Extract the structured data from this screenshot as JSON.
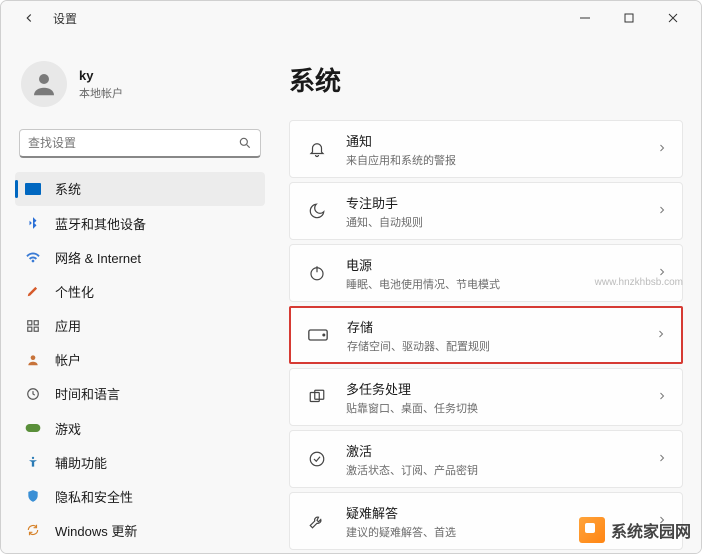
{
  "window": {
    "title": "设置"
  },
  "profile": {
    "name": "ky",
    "subtitle": "本地帐户"
  },
  "search": {
    "placeholder": "查找设置"
  },
  "nav": {
    "items": [
      {
        "label": "系统"
      },
      {
        "label": "蓝牙和其他设备"
      },
      {
        "label": "网络 & Internet"
      },
      {
        "label": "个性化"
      },
      {
        "label": "应用"
      },
      {
        "label": "帐户"
      },
      {
        "label": "时间和语言"
      },
      {
        "label": "游戏"
      },
      {
        "label": "辅助功能"
      },
      {
        "label": "隐私和安全性"
      },
      {
        "label": "Windows 更新"
      }
    ]
  },
  "main": {
    "heading": "系统",
    "cards": [
      {
        "title": "通知",
        "subtitle": "来自应用和系统的警报"
      },
      {
        "title": "专注助手",
        "subtitle": "通知、自动规则"
      },
      {
        "title": "电源",
        "subtitle": "睡眠、电池使用情况、节电模式"
      },
      {
        "title": "存储",
        "subtitle": "存储空间、驱动器、配置规则"
      },
      {
        "title": "多任务处理",
        "subtitle": "贴靠窗口、桌面、任务切换"
      },
      {
        "title": "激活",
        "subtitle": "激活状态、订阅、产品密钥"
      },
      {
        "title": "疑难解答",
        "subtitle": "建议的疑难解答、首选"
      }
    ]
  },
  "watermark": {
    "text": "系统家园网",
    "url": "www.hnzkhbsb.com"
  }
}
